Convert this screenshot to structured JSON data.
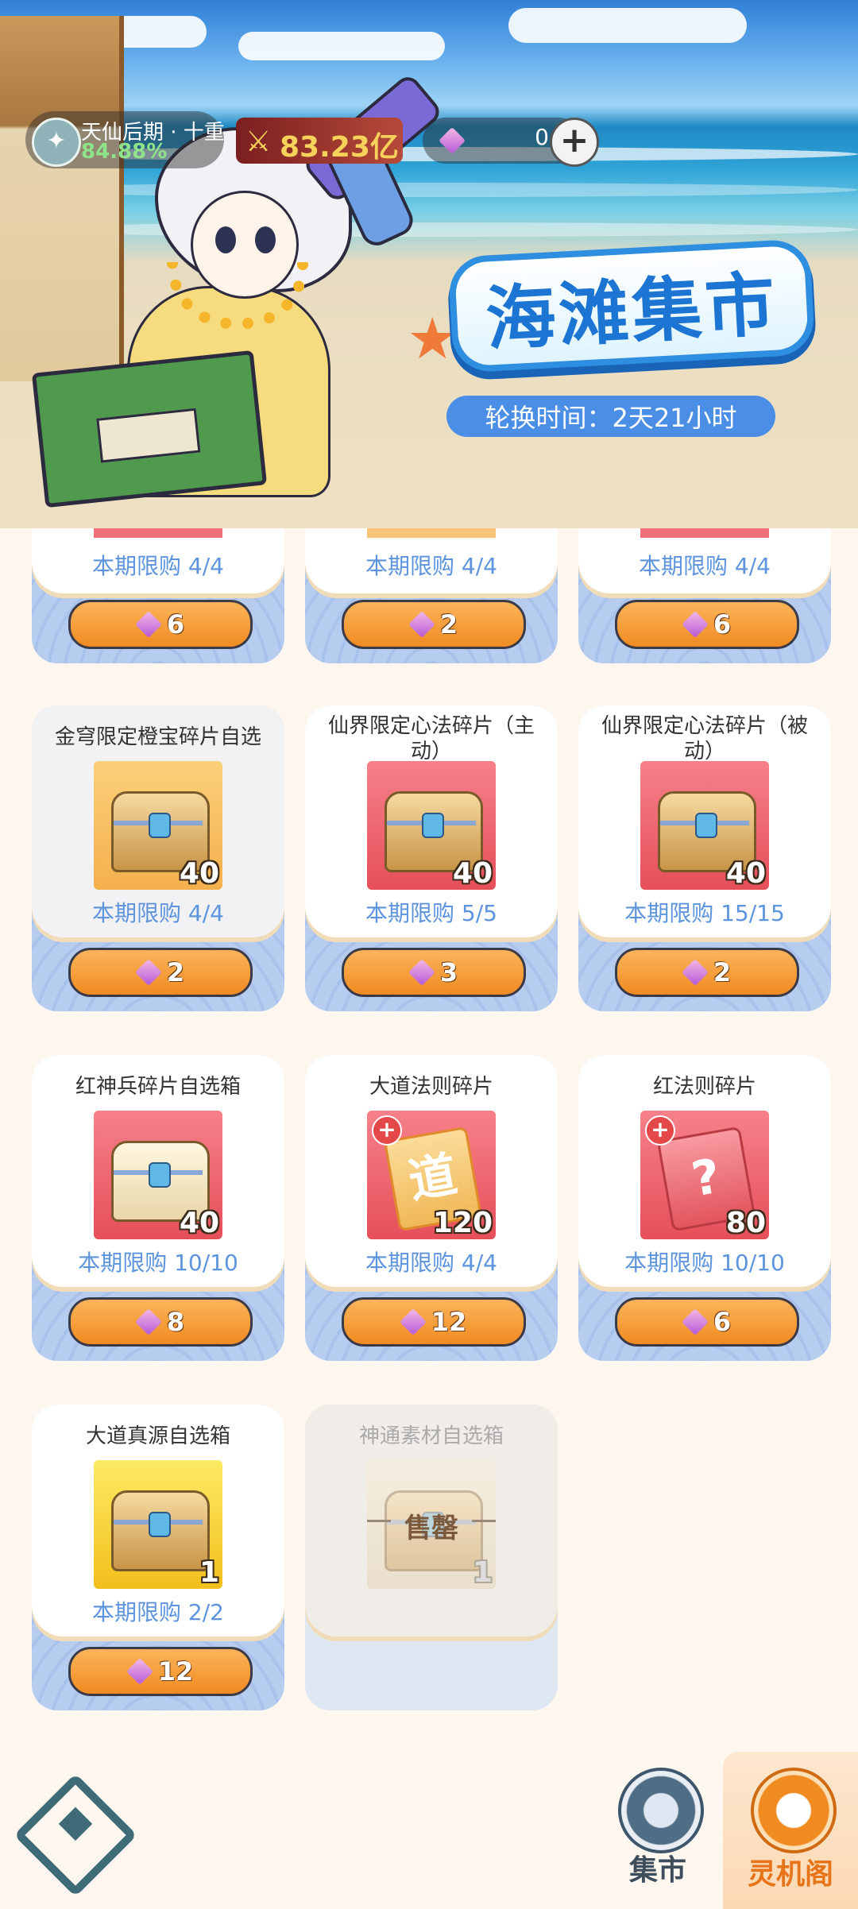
{
  "hud": {
    "realm_name": "天仙后期 · 十重",
    "realm_progress": "84.88%",
    "power": "83.23亿",
    "gems": "0",
    "add_label": "+"
  },
  "banner": {
    "title": "海滩集市",
    "rotation": "轮换时间：2天21小时"
  },
  "partial_row": [
    {
      "limit": "本期限购 4/4",
      "price": "6"
    },
    {
      "limit": "本期限购 4/4",
      "price": "2"
    },
    {
      "limit": "本期限购 4/4",
      "price": "6"
    }
  ],
  "items": [
    {
      "name": "金穹限定橙宝碎片自选",
      "qty": "40",
      "limit": "本期限购 4/4",
      "price": "2"
    },
    {
      "name": "仙界限定心法碎片（主动）",
      "qty": "40",
      "limit": "本期限购 5/5",
      "price": "3"
    },
    {
      "name": "仙界限定心法碎片（被动）",
      "qty": "40",
      "limit": "本期限购 15/15",
      "price": "2"
    },
    {
      "name": "红神兵碎片自选箱",
      "qty": "40",
      "limit": "本期限购 10/10",
      "price": "8"
    },
    {
      "name": "大道法则碎片",
      "qty": "120",
      "limit": "本期限购 4/4",
      "price": "12",
      "glyph": "道"
    },
    {
      "name": "红法则碎片",
      "qty": "80",
      "limit": "本期限购 10/10",
      "price": "6",
      "glyph": "?"
    },
    {
      "name": "大道真源自选箱",
      "qty": "1",
      "limit": "本期限购 2/2",
      "price": "12"
    },
    {
      "name": "神通素材自选箱",
      "qty": "1",
      "sold_label": "售罄"
    }
  ],
  "nav": {
    "market": "集市",
    "lingji": "灵机阁"
  },
  "colors": {
    "accent_orange": "#f08b22",
    "limit_blue": "#5d94de",
    "title_blue": "#1c74d3"
  }
}
